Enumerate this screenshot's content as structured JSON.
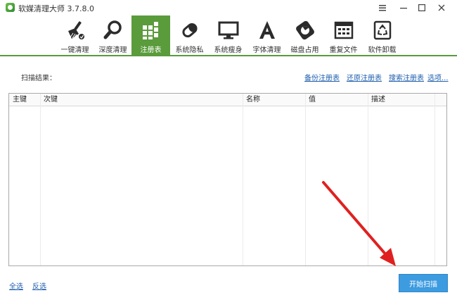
{
  "window": {
    "title": "软媒清理大师 3.7.8.0"
  },
  "toolbar": {
    "items": [
      {
        "label": "一键清理",
        "icon": "broom-icon",
        "active": false
      },
      {
        "label": "深度清理",
        "icon": "magnifier-icon",
        "active": false
      },
      {
        "label": "注册表",
        "icon": "registry-grid-icon",
        "active": true
      },
      {
        "label": "系统隐私",
        "icon": "eraser-icon",
        "active": false
      },
      {
        "label": "系统瘦身",
        "icon": "monitor-icon",
        "active": false
      },
      {
        "label": "字体清理",
        "icon": "font-a-icon",
        "active": false
      },
      {
        "label": "磁盘占用",
        "icon": "disk-pie-icon",
        "active": false
      },
      {
        "label": "重复文件",
        "icon": "duplicate-files-icon",
        "active": false
      },
      {
        "label": "软件卸载",
        "icon": "recycle-bin-icon",
        "active": false
      }
    ]
  },
  "scan": {
    "result_label": "扫描结果：",
    "links": [
      "备份注册表",
      "还原注册表",
      "搜索注册表",
      "选项..."
    ]
  },
  "table": {
    "columns": [
      "主键",
      "次键",
      "名称",
      "值",
      "描述"
    ],
    "rows": []
  },
  "footer": {
    "select_all": "全选",
    "invert_select": "反选",
    "start_scan": "开始扫描"
  },
  "colors": {
    "accent_green": "#5a9b3c",
    "button_blue": "#3d9be0",
    "link_blue": "#1f5fae",
    "annotation_red": "#e02020"
  }
}
